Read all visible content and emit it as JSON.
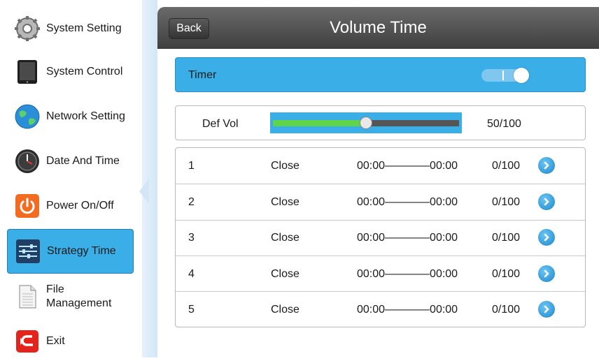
{
  "sidebar": {
    "items": [
      {
        "label": "System Setting",
        "icon": "gear-icon"
      },
      {
        "label": "System Control",
        "icon": "tablet-icon"
      },
      {
        "label": "Network Setting",
        "icon": "globe-icon"
      },
      {
        "label": "Date And Time",
        "icon": "clock-icon"
      },
      {
        "label": "Power On/Off",
        "icon": "power-icon"
      },
      {
        "label": "Strategy Time",
        "icon": "sliders-icon",
        "active": true
      },
      {
        "label1": "File",
        "label2": "Management",
        "icon": "document-icon"
      },
      {
        "label": "Exit",
        "icon": "exit-icon"
      }
    ]
  },
  "header": {
    "back_label": "Back",
    "title": "Volume Time"
  },
  "timer": {
    "label": "Timer",
    "enabled": true
  },
  "default_volume": {
    "label": "Def Vol",
    "value": 50,
    "max": 100,
    "display": "50/100"
  },
  "schedule": {
    "rows": [
      {
        "no": "1",
        "status": "Close",
        "time": "00:00————00:00",
        "volume": "0/100"
      },
      {
        "no": "2",
        "status": "Close",
        "time": "00:00————00:00",
        "volume": "0/100"
      },
      {
        "no": "3",
        "status": "Close",
        "time": "00:00————00:00",
        "volume": "0/100"
      },
      {
        "no": "4",
        "status": "Close",
        "time": "00:00————00:00",
        "volume": "0/100"
      },
      {
        "no": "5",
        "status": "Close",
        "time": "00:00————00:00",
        "volume": "0/100"
      }
    ]
  },
  "colors": {
    "accent": "#3aaee6",
    "header_bg": "#4f4f4f",
    "slider_fill": "#5fd34a"
  }
}
